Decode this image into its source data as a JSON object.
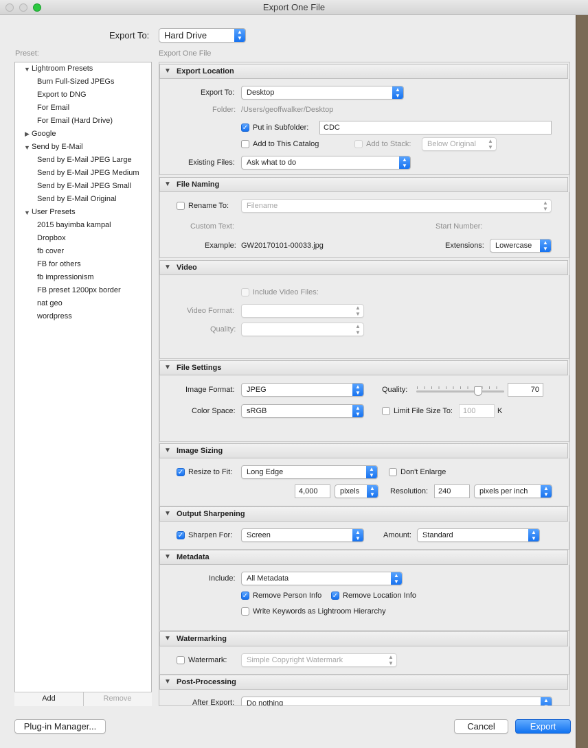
{
  "window": {
    "title": "Export One File"
  },
  "top": {
    "export_to_label": "Export To:",
    "export_to_value": "Hard Drive"
  },
  "presets": {
    "label": "Preset:",
    "groups": [
      {
        "name": "Lightroom Presets",
        "items": [
          "Burn Full-Sized JPEGs",
          "Export to DNG",
          "For Email",
          "For Email (Hard Drive)"
        ]
      },
      {
        "name": "Google",
        "items": []
      },
      {
        "name": "Send by E-Mail",
        "items": [
          "Send by E-Mail JPEG Large",
          "Send by E-Mail JPEG Medium",
          "Send by E-Mail JPEG Small",
          "Send by E-Mail Original"
        ]
      },
      {
        "name": "User Presets",
        "items": [
          "2015 bayimba kampal",
          "Dropbox",
          "fb cover",
          "FB for others",
          "fb impressionism",
          "FB preset 1200px border",
          "nat geo",
          "wordpress"
        ]
      }
    ],
    "add_label": "Add",
    "remove_label": "Remove"
  },
  "main": {
    "header": "Export One File"
  },
  "export_location": {
    "title": "Export Location",
    "export_to_label": "Export To:",
    "export_to_value": "Desktop",
    "folder_label": "Folder:",
    "folder_value": "/Users/geoffwalker/Desktop",
    "subfolder_label": "Put in Subfolder:",
    "subfolder_value": "CDC",
    "add_catalog_label": "Add to This Catalog",
    "add_stack_label": "Add to Stack:",
    "stack_value": "Below Original",
    "existing_label": "Existing Files:",
    "existing_value": "Ask what to do"
  },
  "file_naming": {
    "title": "File Naming",
    "rename_label": "Rename To:",
    "rename_value": "Filename",
    "custom_text_label": "Custom Text:",
    "start_number_label": "Start Number:",
    "example_label": "Example:",
    "example_value": "GW20170101-00033.jpg",
    "extensions_label": "Extensions:",
    "extensions_value": "Lowercase"
  },
  "video": {
    "title": "Video",
    "include_label": "Include Video Files:",
    "format_label": "Video Format:",
    "quality_label": "Quality:"
  },
  "file_settings": {
    "title": "File Settings",
    "format_label": "Image Format:",
    "format_value": "JPEG",
    "quality_label": "Quality:",
    "quality_value": "70",
    "quality_fraction": 0.7,
    "colorspace_label": "Color Space:",
    "colorspace_value": "sRGB",
    "limit_label": "Limit File Size To:",
    "limit_value": "100",
    "limit_unit": "K"
  },
  "image_sizing": {
    "title": "Image Sizing",
    "resize_label": "Resize to Fit:",
    "resize_value": "Long Edge",
    "dont_enlarge_label": "Don't Enlarge",
    "size_value": "4,000",
    "size_unit": "pixels",
    "resolution_label": "Resolution:",
    "resolution_value": "240",
    "resolution_unit": "pixels per inch"
  },
  "output_sharpening": {
    "title": "Output Sharpening",
    "sharpen_label": "Sharpen For:",
    "sharpen_value": "Screen",
    "amount_label": "Amount:",
    "amount_value": "Standard"
  },
  "metadata": {
    "title": "Metadata",
    "include_label": "Include:",
    "include_value": "All Metadata",
    "remove_person_label": "Remove Person Info",
    "remove_location_label": "Remove Location Info",
    "keywords_label": "Write Keywords as Lightroom Hierarchy"
  },
  "watermarking": {
    "title": "Watermarking",
    "watermark_label": "Watermark:",
    "watermark_value": "Simple Copyright Watermark"
  },
  "post_processing": {
    "title": "Post-Processing",
    "after_label": "After Export:",
    "after_value": "Do nothing"
  },
  "footer": {
    "plugin_label": "Plug-in Manager...",
    "cancel_label": "Cancel",
    "export_label": "Export"
  },
  "colors": {
    "accent": "#1470ef"
  }
}
